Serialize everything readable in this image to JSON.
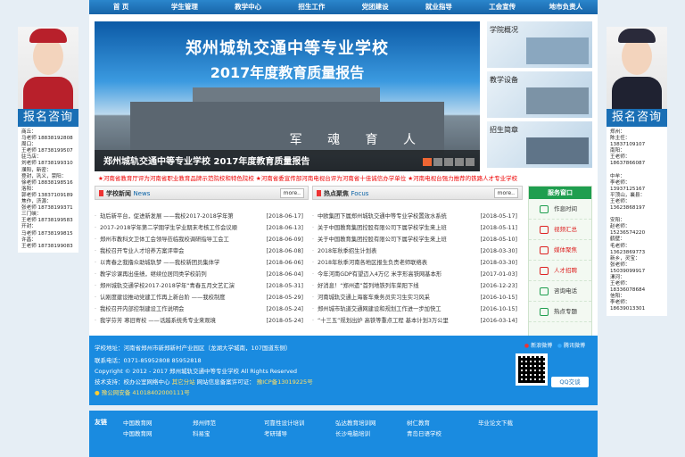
{
  "nav": [
    "首 页",
    "学生管理",
    "教学中心",
    "招生工作",
    "党团建设",
    "就业指导",
    "工会宣传",
    "地市负责人"
  ],
  "banner": {
    "title": "郑州城轨交通中等专业学校",
    "subtitle": "2017年度教育质量报告",
    "caption": "郑州城轨交通中等专业学校 2017年度教育质量报告",
    "sign": "军 魂 育 人"
  },
  "thumbs": [
    "学院概况",
    "教学设备",
    "招生简章"
  ],
  "notice": "★河南省教育厅评为河南省职业教育品牌示范院校和特色院校    ★河南省委宣传部河南电视台评为河南省十佳诚信办学单位    ★河南电视台强力推荐的铁路人才专业学校",
  "school_news": {
    "title": "学校新闻",
    "title_en": "News",
    "more": "more..",
    "items": [
      {
        "t": "劫后新平台，促进新发展 ——我校2017-2018学年第",
        "d": "[2018-06-17]"
      },
      {
        "t": "2017-2018学年第二学期学生学业期末考核工作会议顺",
        "d": "[2018-06-13]"
      },
      {
        "t": "郑州市教科文卫体工会领导莅临我校调研指导工会工",
        "d": "[2018-06-09]"
      },
      {
        "t": "我校召开专业人才培养方案评审会",
        "d": "[2018-06-08]"
      },
      {
        "t": "以青春之我撸众助城轨梦 ——我校新团员集体学",
        "d": "[2018-06-06]"
      },
      {
        "t": "教学诊课再出佳绩，继续位居同类学校前列",
        "d": "[2018-06-04]"
      },
      {
        "t": "郑州城轨交通学校2017-2018学年“青春五月文艺汇演",
        "d": "[2018-05-31]"
      },
      {
        "t": "认刚度建设推动党建工作再上新台阶 ——我校制度",
        "d": "[2018-05-29]"
      },
      {
        "t": "我校召开内部控制建设工作说明会",
        "d": "[2018-05-24]"
      },
      {
        "t": "我学芬芳 寒旧寄校 ——话越系统秀专业来观境",
        "d": "[2018-05-24]"
      }
    ]
  },
  "hot_news": {
    "title": "热点聚焦",
    "title_en": "Focus",
    "more": "more..",
    "items": [
      {
        "t": "中欧集团下属郑州城轨交通中等专业学校置效水系统",
        "d": "[2018-05-17]"
      },
      {
        "t": "关于中国教育集团控股有限公司下属学校学生来上班",
        "d": "[2018-05-11]"
      },
      {
        "t": "关于中国教育集团控股有限公司下属学校学生来上班",
        "d": "[2018-05-10]"
      },
      {
        "t": "2018年秋季招生计划表",
        "d": "[2018-03-30]"
      },
      {
        "t": "2018年秋季河南各地区报生负责老师联络表",
        "d": "[2018-03-30]"
      },
      {
        "t": "今年河南GDP有望迈入4万亿 米字形高铁网基本形",
        "d": "[2017-01-03]"
      },
      {
        "t": "好消息！“郑州遗”首列地铁列车荣阳下线",
        "d": "[2016-12-23]"
      },
      {
        "t": "河南城轨交通上海客车乘务员实习生实习风采",
        "d": "[2016-10-15]"
      },
      {
        "t": "郑州城市轨道交通网建设和规划工作进一步加快工",
        "d": "[2016-10-15]"
      },
      {
        "t": "“十三五”规划出炉 高铁等重点工程 基本计划3万公里",
        "d": "[2016-03-14]"
      }
    ]
  },
  "services": {
    "title": "服务窗口",
    "items": [
      {
        "label": "作息时间",
        "red": false
      },
      {
        "label": "视频汇总",
        "red": true
      },
      {
        "label": "媒体聚焦",
        "red": true
      },
      {
        "label": "人才招聘",
        "red": true
      },
      {
        "label": "咨询电话",
        "red": false
      },
      {
        "label": "热点专题",
        "red": false
      }
    ]
  },
  "left_ad": {
    "title": "报名咨询",
    "contacts": [
      "商丘：",
      "马老师 18838192808",
      "周口：",
      "王老师 18738199507",
      "驻马店：",
      "刘老师 18738199310",
      "濮阳，新密：",
      "登封，巩义，荥阳：",
      "徐老师 18838198516",
      "洛阳：",
      "郭老师 13837109189",
      "焦作，济源：",
      "张老师 18738199371",
      "三门峡：",
      "王老师 18738199583",
      "开封：",
      "马老师 18738199815",
      "许昌：",
      "王老师 18738199083"
    ]
  },
  "right_ad": {
    "title": "报名咨询",
    "contacts": [
      "郑州：",
      "陈主任：13837109107",
      "南阳：",
      "王老师：18637866087",
      "",
      "中牟：",
      "李老师：13937125167",
      "平顶山，襄县：",
      "王老师：13623868197",
      "",
      "安阳：",
      "赵老师：15236574220",
      "鹤壁：",
      "毛老师：13623869773",
      "新乡，灵宝：",
      "张老师：15039099917",
      "漯河：",
      "王老师：18336078684",
      "信阳：",
      "李老师：18639013301"
    ]
  },
  "footer": {
    "address": "学校地址：河南省郑州市新郑新村产业园区（龙湖大学城南，107国道东侧）",
    "phone": "联系电话：0371-85952808  85952818",
    "copyright": "Copyright © 2012 - 2017 郑州城轨交通中等专业学校 All Rights Reserved",
    "tech": "技术支持：校办公室网络中心",
    "tech_hl": "其它分站",
    "record": "网站信息备案许可证：",
    "record_no": "豫ICP备13019225号",
    "police": "豫公网安备 41018402000111号",
    "weibo": "新浪微博",
    "tencent": "腾讯微博",
    "qq": "QQ交谈"
  },
  "links": {
    "label": "友链",
    "items": [
      "中国教育网",
      "郑州师范",
      "可靠性设计培训",
      "弘达教育培训网",
      "树仁教育",
      "毕业论文下载",
      "中国教育网",
      "科易宝",
      "考研辅导",
      "长沙电脑培训",
      "青岛日语学校"
    ]
  }
}
